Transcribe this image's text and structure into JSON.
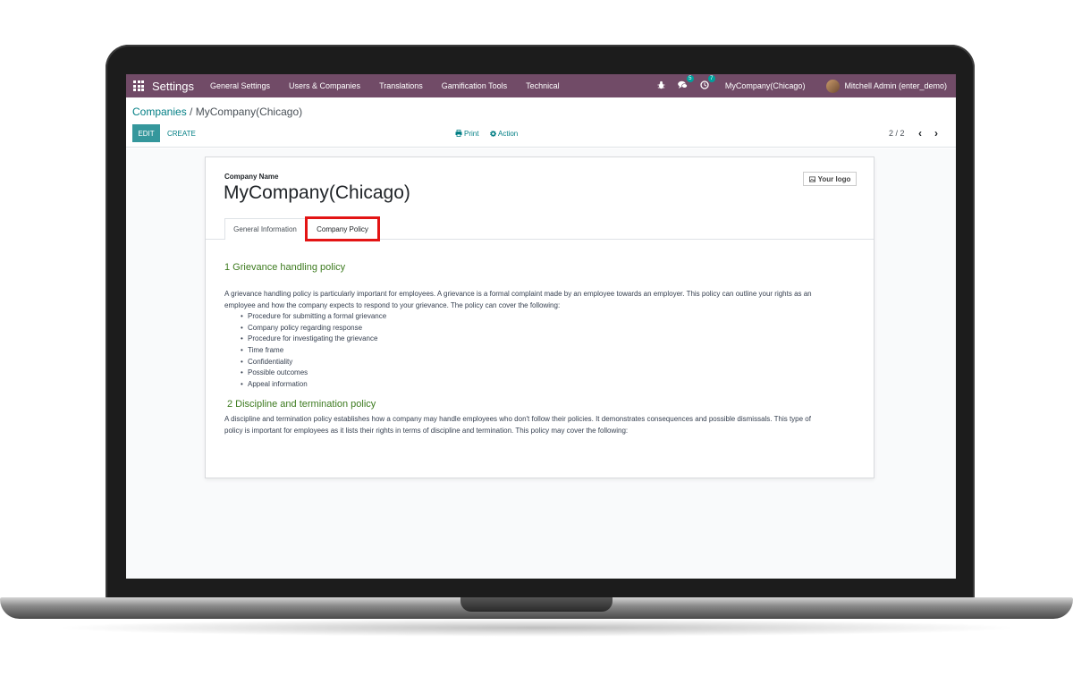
{
  "navbar": {
    "app_title": "Settings",
    "menu": [
      "General Settings",
      "Users & Companies",
      "Translations",
      "Gamification Tools",
      "Technical"
    ],
    "messages_count": "5",
    "activities_count": "7",
    "company": "MyCompany(Chicago)",
    "user": "Mitchell Admin (enter_demo)",
    "icons": [
      "apps-grid-icon",
      "bug-icon",
      "chat-icon",
      "clock-icon"
    ]
  },
  "control_panel": {
    "breadcrumb_parent": "Companies",
    "breadcrumb_separator": "/",
    "breadcrumb_current": "MyCompany(Chicago)",
    "edit_label": "EDIT",
    "create_label": "CREATE",
    "print_label": "Print",
    "action_label": "Action",
    "pager": "2 / 2"
  },
  "form": {
    "field_label": "Company Name",
    "company_name": "MyCompany(Chicago)",
    "logo_label": "Your logo",
    "tabs": [
      "General Information",
      "Company Policy"
    ],
    "active_tab": "Company Policy",
    "highlight_color": "#e31414"
  },
  "policy": {
    "section1_title": "1 Grievance handling policy",
    "section1_para1": "A grievance handling policy is particularly important for employees. A grievance is a formal complaint made by an employee towards an employer. This policy can outline your rights as an",
    "section1_para2": "employee and how the company expects to respond to your grievance. The policy can cover the following:",
    "section1_items": [
      "Procedure for submitting a formal grievance",
      "Company policy regarding response",
      "Procedure for investigating the grievance",
      "Time frame",
      "Confidentiality",
      "Possible outcomes",
      "Appeal information"
    ],
    "section2_title": "2 Discipline and termination policy",
    "section2_para1": "A discipline and termination policy establishes how a company may handle employees who don't follow their policies. It demonstrates consequences and possible dismissals. This type of",
    "section2_para2": "policy is important for employees as it lists their rights in terms of discipline and termination. This policy may cover the following:"
  },
  "colors": {
    "navbar": "#714b67",
    "accent": "#017e84",
    "edit_button": "#35979c",
    "section_heading": "#3c7a1e"
  }
}
